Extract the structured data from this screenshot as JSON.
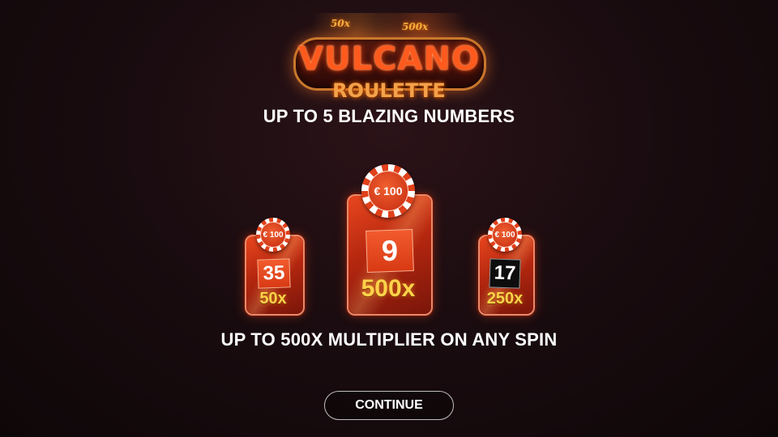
{
  "logo": {
    "title": "VULCANO",
    "subtitle": "ROULETTE",
    "badge_left": "50x",
    "badge_right": "500x"
  },
  "headline_top": "UP TO 5 BLAZING NUMBERS",
  "headline_bottom": "UP TO 500X MULTIPLIER ON ANY SPIN",
  "cards": {
    "left": {
      "chip": "€ 100",
      "number": "35",
      "number_color": "red",
      "multiplier": "50x"
    },
    "center": {
      "chip": "€ 100",
      "number": "9",
      "number_color": "red",
      "multiplier": "500x"
    },
    "right": {
      "chip": "€ 100",
      "number": "17",
      "number_color": "black",
      "multiplier": "250x"
    }
  },
  "continue_label": "CONTINUE",
  "colors": {
    "background": "#1a0c10",
    "card_red": "#c9300f",
    "multiplier_gold": "#ffd24a",
    "chip_red": "#e0401a"
  },
  "icons": [
    "casino-chip-icon"
  ]
}
